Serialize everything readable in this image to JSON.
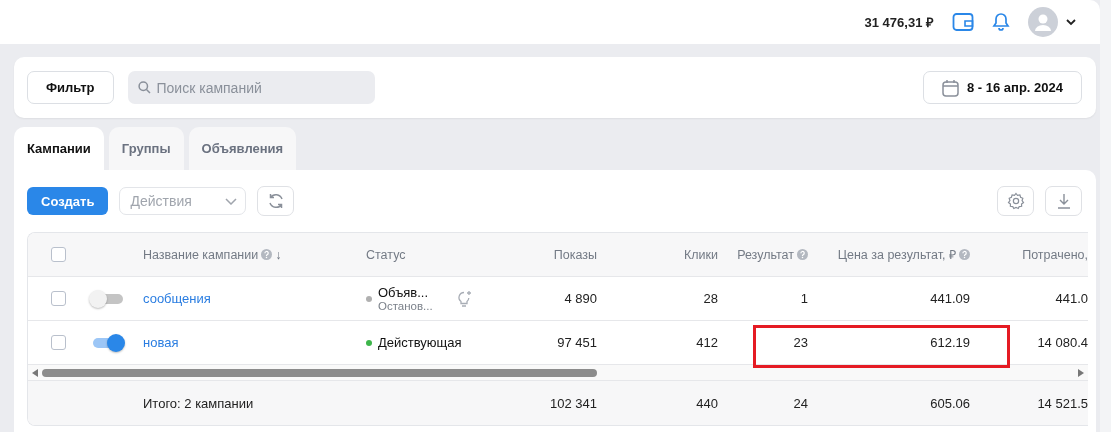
{
  "header": {
    "balance": "31 476,31 ₽"
  },
  "filter": {
    "button": "Фильтр",
    "search": {
      "placeholder": "Поиск кампаний"
    },
    "date_range": "8 - 16 апр. 2024"
  },
  "tabs": [
    {
      "label": "Кампании",
      "selected": true
    },
    {
      "label": "Группы",
      "selected": false
    },
    {
      "label": "Объявления",
      "selected": false
    }
  ],
  "toolbar": {
    "create": "Создать",
    "actions": {
      "placeholder": "Действия"
    }
  },
  "table": {
    "header_checked": false,
    "columns": {
      "name": {
        "label": "Название кампании",
        "help": true,
        "sort": "↓"
      },
      "status": {
        "label": "Статус"
      },
      "shows": {
        "label": "Показы"
      },
      "clicks": {
        "label": "Клики"
      },
      "result": {
        "label": "Результат",
        "help": true
      },
      "price": {
        "label": "Цена за результат, ₽",
        "help": true
      },
      "spent": {
        "label": "Потрачено,"
      }
    },
    "rows": [
      {
        "checked": false,
        "on": false,
        "name": "сообщения",
        "status": "Объяв...",
        "status_note": "Останов...",
        "color": "#b0b0b0",
        "hint": true,
        "shows": "4 890",
        "clicks": "28",
        "result": "1",
        "price": "441.09",
        "spent": "441.0"
      },
      {
        "checked": false,
        "on": true,
        "name": "новая",
        "status": "Действующая",
        "color": "#3db54a",
        "hint": false,
        "shows": "97 451",
        "clicks": "412",
        "result": "23",
        "price": "612.19",
        "spent": "14 080.4"
      }
    ],
    "total": {
      "label": "Итого: 2 кампании",
      "shows": "102 341",
      "clicks": "440",
      "result": "24",
      "price": "605.06",
      "spent": "14 521.5"
    }
  }
}
